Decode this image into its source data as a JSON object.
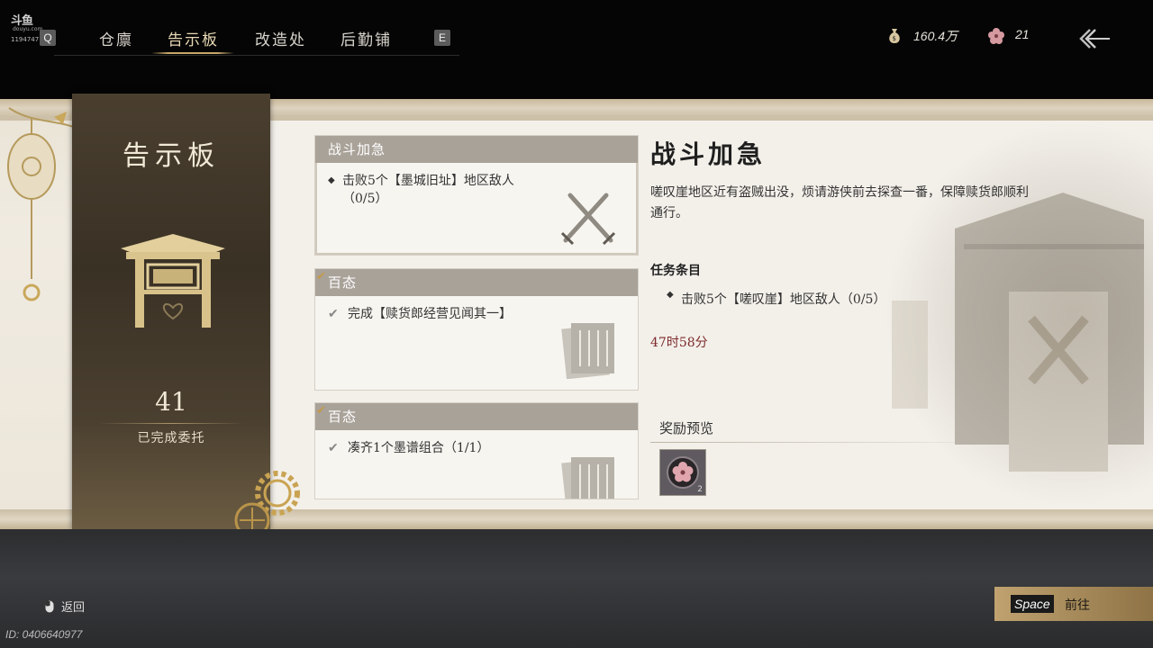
{
  "watermark": {
    "logo": "斗鱼",
    "sub": "douyu.com",
    "room": "1194747"
  },
  "nav": {
    "key_left": "Q",
    "key_right": "E",
    "tabs": [
      {
        "label": "仓廪"
      },
      {
        "label": "告示板"
      },
      {
        "label": "改造处"
      },
      {
        "label": "后勤铺"
      }
    ],
    "active_tab": 1
  },
  "resources": {
    "money": "160.4万",
    "blossom": "21"
  },
  "banner": {
    "title": "告示板",
    "count": "41",
    "subtitle": "已完成委托"
  },
  "cards": [
    {
      "header": "战斗加急",
      "objective": "击败5个【墨城旧址】地区敌人（0/5）",
      "icon": "crossed-swords-icon",
      "completed": false
    },
    {
      "header": "百态",
      "objective": "完成【赎货郎经营见闻其一】",
      "icon": "scroll-icon",
      "completed": true
    },
    {
      "header": "百态",
      "objective": "凑齐1个墨谱组合（1/1）",
      "icon": "scroll-icon",
      "completed": true
    }
  ],
  "detail": {
    "title": "战斗加急",
    "description": "嗟叹崖地区近有盗贼出没，烦请游侠前去探查一番，保障赎货郎顺利通行。",
    "section_label": "任务条目",
    "objective": "击败5个【嗟叹崖】地区敌人（0/5）",
    "time_left": "47时58分",
    "reward_label": "奖励预览",
    "reward_count": "2"
  },
  "footer": {
    "back_label": "返回",
    "id_text": "ID: 0406640977",
    "space_key": "Space",
    "space_label": "前往"
  },
  "colors": {
    "accent_gold": "#c8a86a",
    "time_red": "#7d2a2a",
    "card_header": "#a9a299"
  }
}
